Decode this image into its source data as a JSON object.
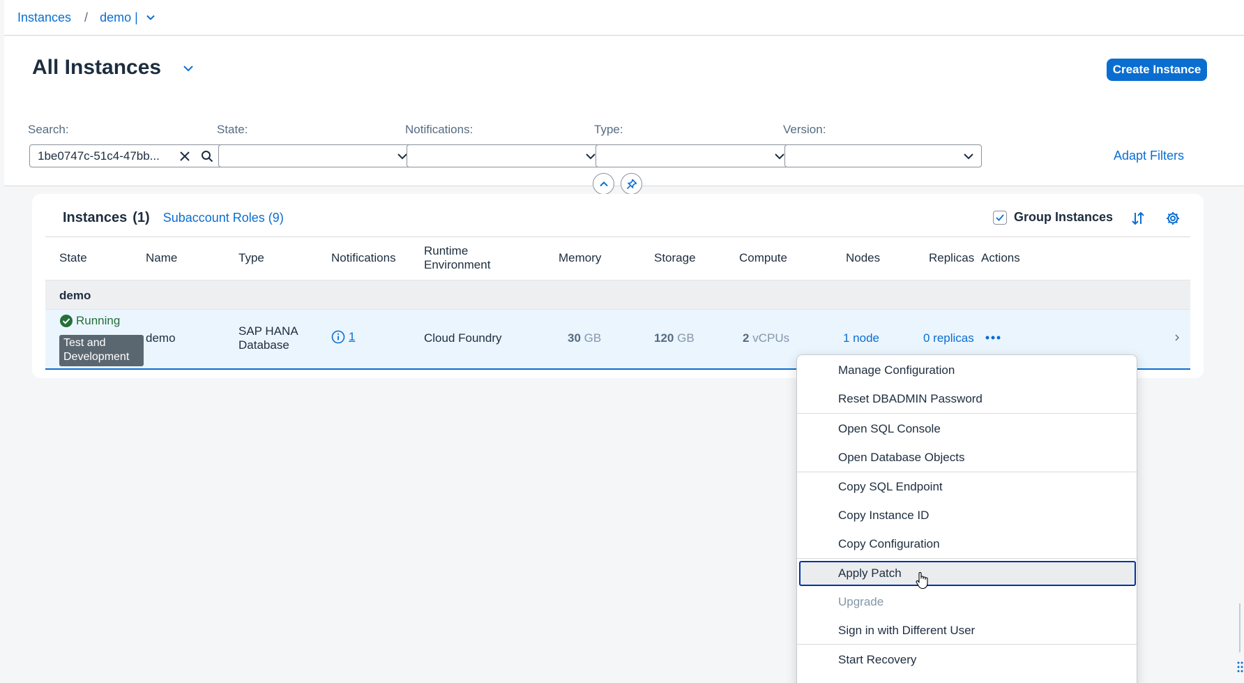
{
  "breadcrumb": {
    "root": "Instances",
    "separator": "/",
    "current": "demo |"
  },
  "header": {
    "title": "All Instances",
    "create_button": "Create Instance",
    "adapt_filters": "Adapt Filters",
    "filters": {
      "search": {
        "label": "Search:",
        "value": "1be0747c-51c4-47bb..."
      },
      "state": {
        "label": "State:"
      },
      "notifications": {
        "label": "Notifications:"
      },
      "type": {
        "label": "Type:"
      },
      "version": {
        "label": "Version:"
      }
    }
  },
  "table": {
    "title": "Instances",
    "count": "(1)",
    "roles_link": "Subaccount Roles (9)",
    "group_instances": "Group Instances",
    "columns": {
      "state": "State",
      "name": "Name",
      "type": "Type",
      "notifications": "Notifications",
      "runtime_line1": "Runtime",
      "runtime_line2": "Environment",
      "memory": "Memory",
      "storage": "Storage",
      "compute": "Compute",
      "nodes": "Nodes",
      "replicas": "Replicas",
      "actions": "Actions"
    },
    "group": "demo",
    "row": {
      "state": "Running",
      "tag_line1": "Test and",
      "tag_line2": "Development",
      "name": "demo",
      "type_line1": "SAP HANA",
      "type_line2": "Database",
      "notifications_count": "1",
      "runtime": "Cloud Foundry",
      "memory_value": "30",
      "memory_unit": "GB",
      "storage_value": "120",
      "storage_unit": "GB",
      "compute_value": "2",
      "compute_unit": "vCPUs",
      "nodes": "1 node",
      "replicas": "0 replicas"
    }
  },
  "menu": {
    "items": [
      "Manage Configuration",
      "Reset DBADMIN Password",
      "Open SQL Console",
      "Open Database Objects",
      "Copy SQL Endpoint",
      "Copy Instance ID",
      "Copy Configuration",
      "Apply Patch",
      "Upgrade",
      "Sign in with Different User",
      "Start Recovery"
    ]
  },
  "colors": {
    "accent": "#0a6ed1",
    "positive": "#256f3a",
    "tag": "#5b6770",
    "focus": "#0032a5"
  }
}
